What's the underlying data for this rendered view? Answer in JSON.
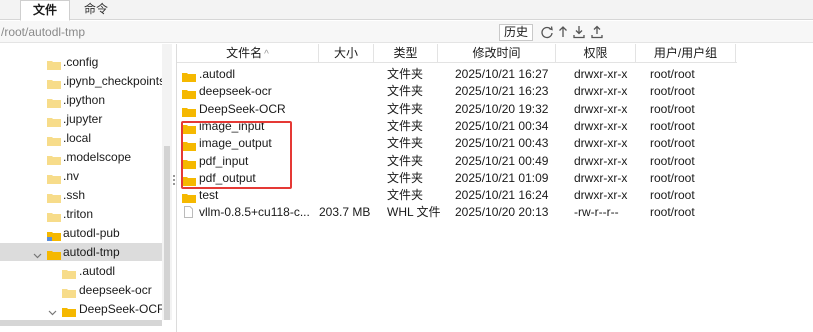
{
  "tabs": [
    {
      "label": "文件",
      "active": true
    },
    {
      "label": "命令",
      "active": false
    }
  ],
  "path": {
    "value": "/root/autodl-tmp"
  },
  "toolbar": {
    "history_label": "历史",
    "icons": [
      "refresh-icon",
      "up-directory-icon",
      "download-icon",
      "upload-icon"
    ]
  },
  "colors": {
    "folder": "#f5b800",
    "selection": "#dcdcdc",
    "highlight": "#e53935"
  },
  "tree": {
    "items": [
      {
        "label": ".config",
        "type": "folder-light",
        "depth": 1
      },
      {
        "label": ".ipynb_checkpoints",
        "type": "folder-light",
        "depth": 1
      },
      {
        "label": ".ipython",
        "type": "folder-light",
        "depth": 1
      },
      {
        "label": ".jupyter",
        "type": "folder-light",
        "depth": 1
      },
      {
        "label": ".local",
        "type": "folder-light",
        "depth": 1
      },
      {
        "label": ".modelscope",
        "type": "folder-light",
        "depth": 1
      },
      {
        "label": ".nv",
        "type": "folder-light",
        "depth": 1
      },
      {
        "label": ".ssh",
        "type": "folder-light",
        "depth": 1
      },
      {
        "label": ".triton",
        "type": "folder-light",
        "depth": 1
      },
      {
        "label": "autodl-pub",
        "type": "folder-link",
        "depth": 1
      },
      {
        "label": "autodl-tmp",
        "type": "folder",
        "depth": 1,
        "expanded": true,
        "selected": true
      },
      {
        "label": ".autodl",
        "type": "folder-light",
        "depth": 2
      },
      {
        "label": "deepseek-ocr",
        "type": "folder-light",
        "depth": 2
      },
      {
        "label": "DeepSeek-OCR",
        "type": "folder",
        "depth": 2,
        "expanded": true
      }
    ]
  },
  "list": {
    "columns": [
      "文件名",
      "大小",
      "类型",
      "修改时间",
      "权限",
      "用户/用户组"
    ],
    "sort_indicator": "^",
    "rows": [
      {
        "name": ".autodl",
        "size": "",
        "type": "文件夹",
        "modified": "2025/10/21 16:27",
        "perm": "drwxr-xr-x",
        "owner": "root/root",
        "kind": "folder"
      },
      {
        "name": "deepseek-ocr",
        "size": "",
        "type": "文件夹",
        "modified": "2025/10/21 16:23",
        "perm": "drwxr-xr-x",
        "owner": "root/root",
        "kind": "folder"
      },
      {
        "name": "DeepSeek-OCR",
        "size": "",
        "type": "文件夹",
        "modified": "2025/10/20 19:32",
        "perm": "drwxr-xr-x",
        "owner": "root/root",
        "kind": "folder"
      },
      {
        "name": "image_input",
        "size": "",
        "type": "文件夹",
        "modified": "2025/10/21 00:34",
        "perm": "drwxr-xr-x",
        "owner": "root/root",
        "kind": "folder"
      },
      {
        "name": "image_output",
        "size": "",
        "type": "文件夹",
        "modified": "2025/10/21 00:43",
        "perm": "drwxr-xr-x",
        "owner": "root/root",
        "kind": "folder"
      },
      {
        "name": "pdf_input",
        "size": "",
        "type": "文件夹",
        "modified": "2025/10/21 00:49",
        "perm": "drwxr-xr-x",
        "owner": "root/root",
        "kind": "folder"
      },
      {
        "name": "pdf_output",
        "size": "",
        "type": "文件夹",
        "modified": "2025/10/21 01:09",
        "perm": "drwxr-xr-x",
        "owner": "root/root",
        "kind": "folder"
      },
      {
        "name": "test",
        "size": "",
        "type": "文件夹",
        "modified": "2025/10/21 16:24",
        "perm": "drwxr-xr-x",
        "owner": "root/root",
        "kind": "folder"
      },
      {
        "name": "vllm-0.8.5+cu118-c...",
        "size": "203.7 MB",
        "type": "WHL 文件",
        "modified": "2025/10/20 20:13",
        "perm": "-rw-r--r--",
        "owner": "root/root",
        "kind": "file"
      }
    ]
  }
}
